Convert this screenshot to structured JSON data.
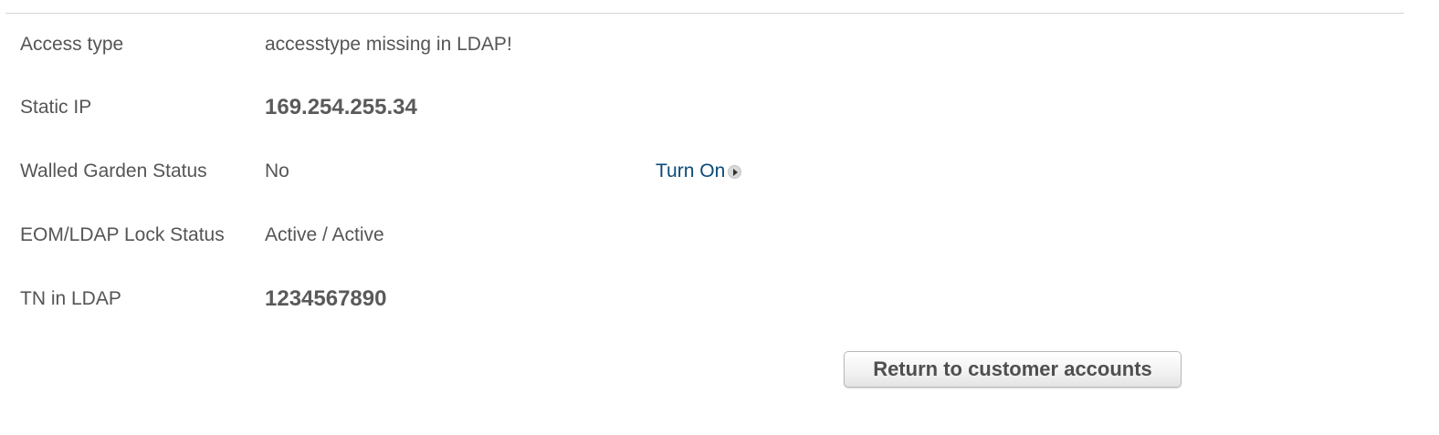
{
  "details": {
    "rows": [
      {
        "label": "Access type",
        "value": "accesstype missing in LDAP!"
      },
      {
        "label": "Static IP",
        "value": "169.254.255.34"
      },
      {
        "label": "Walled Garden Status",
        "value": "No",
        "action_label": "Turn On",
        "action_icon": "arrow-right-circle-icon"
      },
      {
        "label": "EOM/LDAP Lock Status",
        "value": "Active / Active"
      },
      {
        "label": "TN in LDAP",
        "value": "1234567890"
      }
    ]
  },
  "footer": {
    "return_button_label": "Return to customer accounts"
  },
  "colors": {
    "text": "#555555",
    "link": "#0b4a76",
    "divider": "#d6d6d6"
  }
}
